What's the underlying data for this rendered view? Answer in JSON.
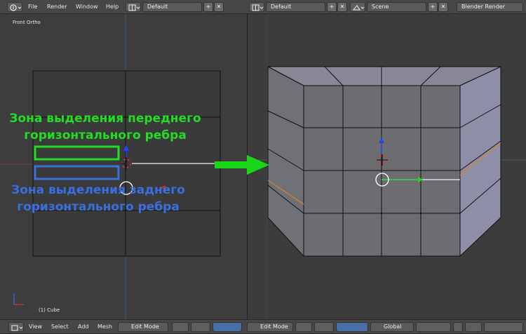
{
  "menu": {
    "file": "File",
    "render": "Render",
    "window": "Window",
    "help": "Help"
  },
  "screen_layout": {
    "value": "Default"
  },
  "screen_layout_2": {
    "value": "Default"
  },
  "scene": {
    "value": "Scene"
  },
  "render_engine": {
    "value": "Blender Render"
  },
  "viewport": {
    "view_label": "Front Ortho",
    "object_label": "(1) Cube"
  },
  "annotations": {
    "front_edge_line1": "Зона выделения переднего",
    "front_edge_line2": "горизонтального ребра",
    "back_edge_line1": "Зона выделения заднего",
    "back_edge_line2": "горизонтального ребра",
    "front_color": "#22dd22",
    "back_color": "#3a6fe0"
  },
  "bottom_left": {
    "view": "View",
    "select": "Select",
    "add": "Add",
    "mesh": "Mesh",
    "mode": "Edit Mode"
  },
  "bottom_right": {
    "mode": "Edit Mode",
    "orientation": "Global"
  }
}
